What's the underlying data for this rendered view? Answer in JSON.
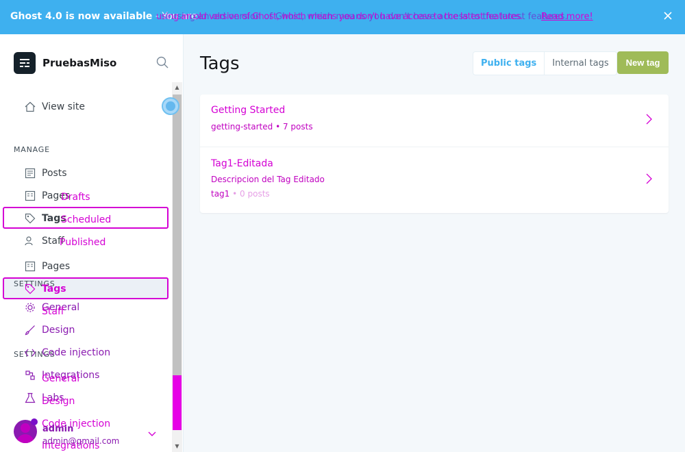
{
  "banner": {
    "bold": "Ghost 4.0 is now available",
    "text": " - You are using an old version of Ghost, which means you don't have access to the latest features.",
    "learn_more": "Read more!"
  },
  "sidebar": {
    "site_name": "PruebasMiso",
    "view_site": "View site",
    "manage_label": "MANAGE",
    "posts": "Posts",
    "drafts": "Drafts",
    "scheduled": "Scheduled",
    "published": "Published",
    "pages": "Pages",
    "tags": "Tags",
    "staff": "Staff",
    "settings_label": "SETTINGS",
    "general": "General",
    "design": "Design",
    "code_injection": "Code injection",
    "integrations": "Integrations",
    "labs": "Labs",
    "user_name": "admin",
    "user_email": "admin@gmail.com"
  },
  "main": {
    "title": "Tags",
    "tab_public": "Public tags",
    "tab_internal": "Internal tags",
    "new_tag": "New tag",
    "tags": [
      {
        "name": "Getting Started",
        "slug": "getting-started",
        "count": "7 posts",
        "description": ""
      },
      {
        "name": "Tag1-Editada",
        "slug": "tag1",
        "count": "0 posts",
        "description": "Descripcion del Tag Editado"
      }
    ]
  },
  "colors": {
    "accent": "#3eb0ef",
    "new_tag_button": "#9fbb58",
    "overlay": "#d400d4"
  }
}
